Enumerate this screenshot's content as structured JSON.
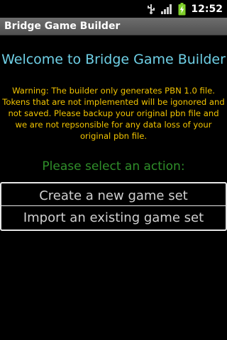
{
  "status_bar": {
    "time": "12:52",
    "icons": [
      "usb-debug-icon",
      "signal-icon",
      "battery-charging-icon"
    ]
  },
  "title_bar": {
    "title": "Bridge Game Builder"
  },
  "main": {
    "welcome": "Welcome to Bridge Game Builder",
    "warning": "Warning: The builder only generates PBN 1.0 file. Tokens that are not implemented will be igonored and not saved. Please backup your original pbn file and we are not repsonsible for any data loss of your original pbn file.",
    "prompt": "Please select an action:",
    "actions": [
      {
        "label": "Create a new game set"
      },
      {
        "label": "Import an existing game set"
      }
    ]
  },
  "colors": {
    "background": "#000000",
    "welcome": "#6fd0e6",
    "warning": "#f2c400",
    "prompt": "#2f8f2a",
    "action_text": "#d0d0d0"
  }
}
